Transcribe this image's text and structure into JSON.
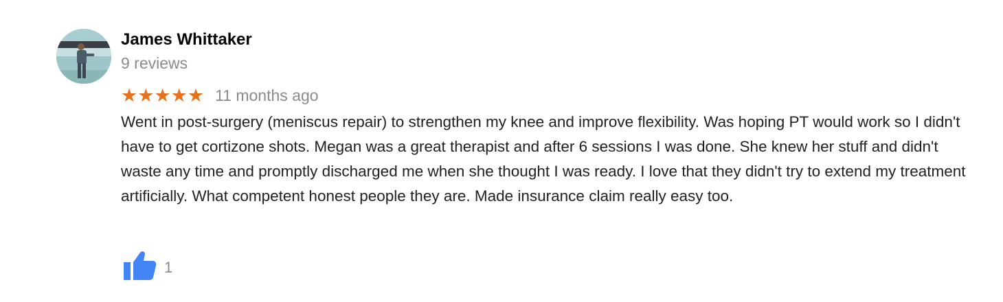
{
  "reviewer": {
    "name": "James Whittaker",
    "review_count": "9 reviews"
  },
  "rating": {
    "stars": 5,
    "max_stars": 5,
    "star_glyph": "★",
    "star_color": "#e7711b"
  },
  "review": {
    "time": "11 months ago",
    "text": "Went in post-surgery (meniscus repair) to strengthen my knee and improve flexibility. Was hoping PT would work so I didn't have to get cortizone shots. Megan was a great therapist and after 6 sessions I was done. She knew her stuff and didn't waste any time and promptly discharged me when she thought I was ready. I love that they didn't try to extend my treatment artificially. What competent honest people they are. Made insurance claim really easy too."
  },
  "actions": {
    "like_icon": "thumbs-up-icon",
    "like_count": "1",
    "like_color": "#4285f4"
  }
}
